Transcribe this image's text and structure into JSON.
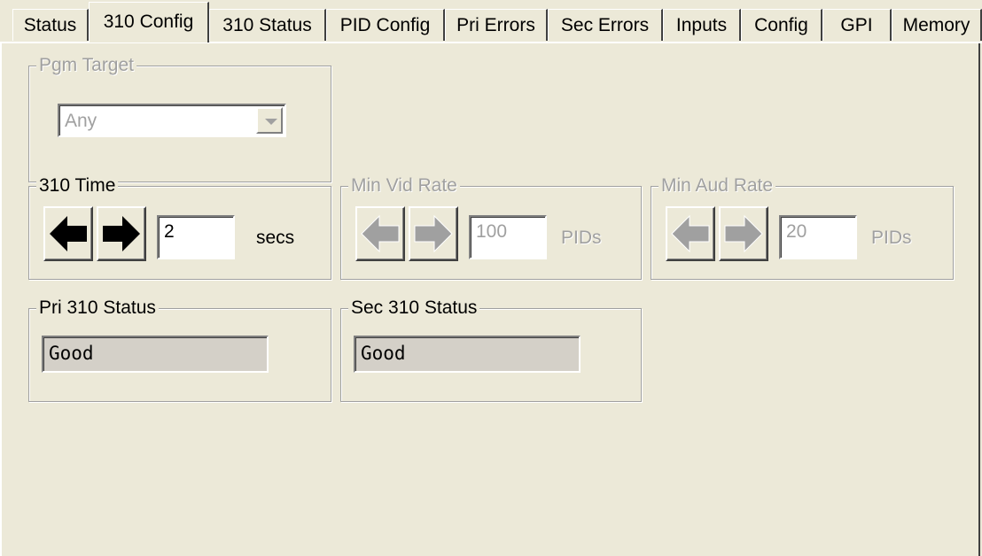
{
  "tabs": [
    {
      "label": "Status"
    },
    {
      "label": "310 Config"
    },
    {
      "label": "310 Status"
    },
    {
      "label": "PID Config"
    },
    {
      "label": "Pri Errors"
    },
    {
      "label": "Sec Errors"
    },
    {
      "label": "Inputs"
    },
    {
      "label": "Config"
    },
    {
      "label": "GPI"
    },
    {
      "label": "Memory"
    }
  ],
  "active_tab": "310 Config",
  "pgm_target": {
    "label": "Pgm Target",
    "value": "Any",
    "enabled": false
  },
  "time_310": {
    "label": "310 Time",
    "value": "2",
    "unit": "secs",
    "enabled": true
  },
  "min_vid_rate": {
    "label": "Min Vid Rate",
    "value": "100",
    "unit": "PIDs",
    "enabled": false
  },
  "min_aud_rate": {
    "label": "Min Aud Rate",
    "value": "20",
    "unit": "PIDs",
    "enabled": false
  },
  "pri_status": {
    "label": "Pri 310 Status",
    "value": "Good"
  },
  "sec_status": {
    "label": "Sec 310 Status",
    "value": "Good"
  },
  "icons": {
    "left": "left-arrow-icon",
    "right": "right-arrow-icon",
    "dropdown": "chevron-down-icon"
  },
  "colors": {
    "background": "#ece9d8",
    "enabled_arrow": "#000000",
    "disabled_arrow": "#a0a0a0",
    "status_field": "#d4d0c8"
  }
}
